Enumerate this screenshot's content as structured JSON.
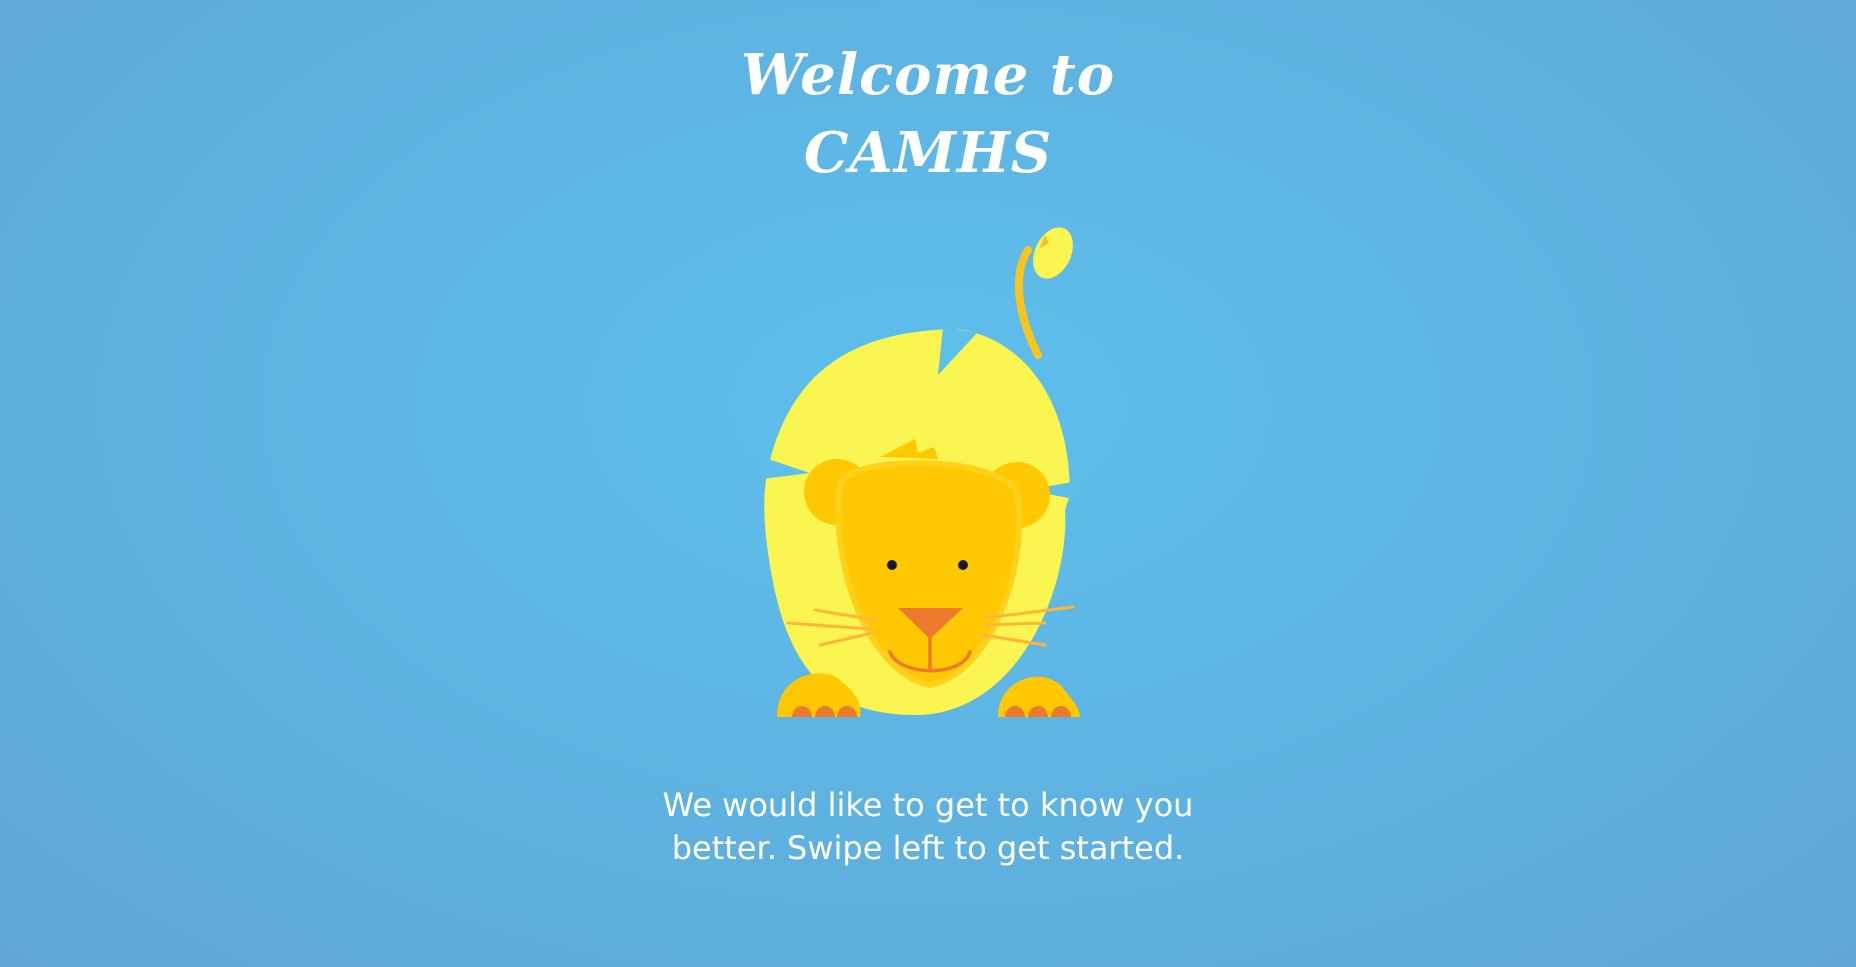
{
  "welcome": {
    "title_line1": "Welcome to",
    "title_line2": "CAMHS",
    "message": "We would like to get to know you better. Swipe left to get started."
  },
  "illustration": {
    "icon": "lion-icon"
  },
  "colors": {
    "background": "#5dbfec",
    "mane": "#fbf551",
    "face": "#ffc800",
    "nose": "#ec7a2a",
    "text": "#ffffff"
  }
}
